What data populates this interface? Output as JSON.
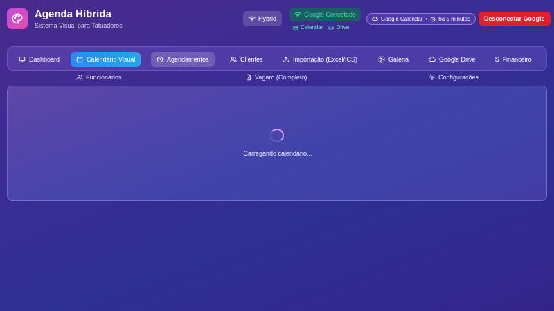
{
  "app": {
    "title": "Agenda Híbrida",
    "subtitle": "Sistema Visual para Tatuadores"
  },
  "status": {
    "hybrid_label": "Hybrid",
    "google_connected": "Google Conectado",
    "google_services": [
      "Calendar",
      "Drive"
    ],
    "calendar_sync": "Google Calendar",
    "sync_time": "há 5 minutos",
    "disconnect_label": "Desconectar Google"
  },
  "nav": {
    "tabs": [
      {
        "label": "Dashboard",
        "icon": "monitor-icon"
      },
      {
        "label": "Calendário Visual",
        "icon": "calendar-icon",
        "active": true
      },
      {
        "label": "Agendamentos",
        "icon": "clock-icon"
      },
      {
        "label": "Clientes",
        "icon": "users-icon"
      },
      {
        "label": "Importação (Excel/ICS)",
        "icon": "upload-icon"
      },
      {
        "label": "Galeria",
        "icon": "image-icon"
      },
      {
        "label": "Google Drive",
        "icon": "cloud-icon"
      },
      {
        "label": "Financeiro",
        "icon": "dollar-icon"
      }
    ],
    "secondary": [
      {
        "label": "Funcionários",
        "icon": "users-icon"
      },
      {
        "label": "Vagaro (Completo)",
        "icon": "file-icon"
      },
      {
        "label": "Configurações",
        "icon": "gear-icon"
      }
    ]
  },
  "main": {
    "loading_text": "Carregando calendário..."
  },
  "colors": {
    "accent": "#2a8cf5",
    "connected": "#35e38a",
    "danger": "#e01e2c",
    "spinner": "#e29aff"
  }
}
